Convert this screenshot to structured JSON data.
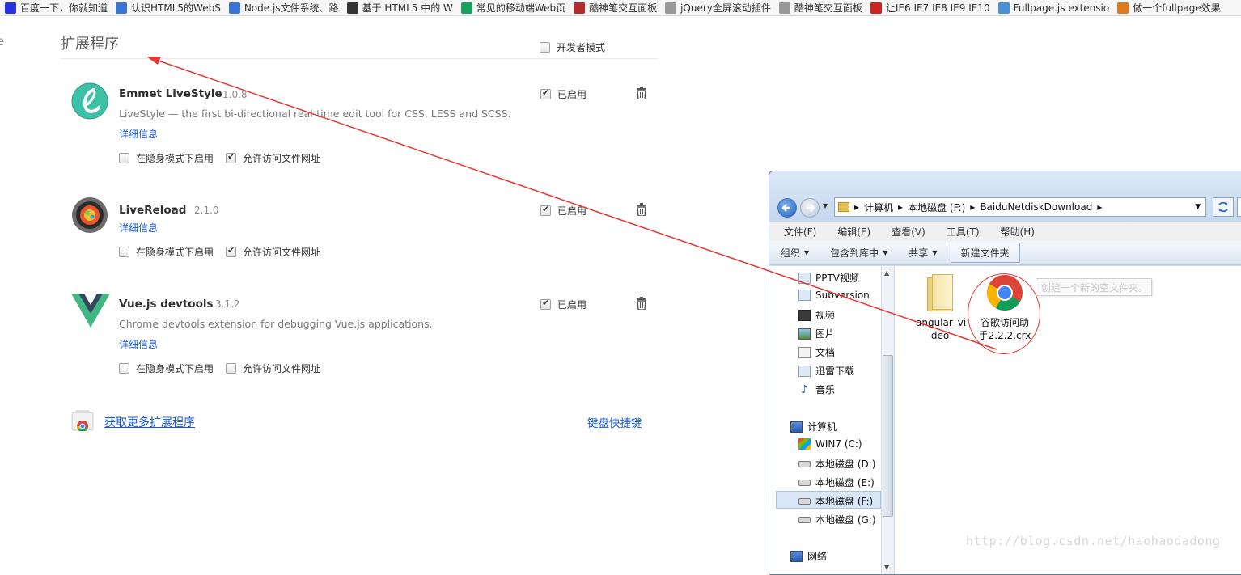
{
  "bookmarks": [
    {
      "label": "百度一下，你就知道",
      "icon": "paw-icon",
      "color": "#2932e1"
    },
    {
      "label": "认识HTML5的WebS",
      "icon": "globe-icon",
      "color": "#3a74d6"
    },
    {
      "label": "Node.js文件系统、路",
      "icon": "globe-icon",
      "color": "#3a74d6"
    },
    {
      "label": "基于 HTML5 中的 W",
      "icon": "github-icon",
      "color": "#333333"
    },
    {
      "label": "常见的移动端Web页",
      "icon": "refresh-icon",
      "color": "#19a15f"
    },
    {
      "label": "酷神笔交互面板",
      "icon": "brand-icon",
      "color": "#b52a2a"
    },
    {
      "label": "jQuery全屏滚动插件",
      "icon": "page-icon",
      "color": "#999999"
    },
    {
      "label": "酷神笔交互面板",
      "icon": "page-icon",
      "color": "#999999"
    },
    {
      "label": "让IE6 IE7 IE8 IE9 IE10",
      "icon": "csdn-icon",
      "color": "#c9251c"
    },
    {
      "label": "Fullpage.js extensio",
      "icon": "cloud-icon",
      "color": "#4a90d9"
    },
    {
      "label": "做一个fullpage效果",
      "icon": "blog-icon",
      "color": "#e07a1a"
    }
  ],
  "left_sliver": "e",
  "extensions_page": {
    "title": "扩展程序",
    "dev_mode_label": "开发者模式",
    "extensions": [
      {
        "name": "Emmet LiveStyle",
        "version": "1.0.8",
        "description": "LiveStyle — the first bi-directional real-time edit tool for CSS, LESS and SCSS.",
        "details_link": "详细信息",
        "enabled_label": "已启用",
        "enabled": true,
        "incognito_label": "在隐身模式下启用",
        "incognito": false,
        "file_access_label": "允许访问文件网址",
        "file_access": true,
        "icon": "livestyle-icon"
      },
      {
        "name": "LiveReload",
        "version": "2.1.0",
        "description": "",
        "details_link": "详细信息",
        "enabled_label": "已启用",
        "enabled": true,
        "incognito_label": "在隐身模式下启用",
        "incognito": false,
        "file_access_label": "允许访问文件网址",
        "file_access": true,
        "icon": "livereload-icon"
      },
      {
        "name": "Vue.js devtools",
        "version": "3.1.2",
        "description": "Chrome devtools extension for debugging Vue.js applications.",
        "details_link": "详细信息",
        "enabled_label": "已启用",
        "enabled": true,
        "incognito_label": "在隐身模式下启用",
        "incognito": false,
        "file_access_label": "允许访问文件网址",
        "file_access": false,
        "icon": "vue-icon"
      }
    ],
    "get_more_label": "获取更多扩展程序",
    "shortcuts_label": "键盘快捷键"
  },
  "explorer": {
    "breadcrumb": [
      "计算机",
      "本地磁盘 (F:)",
      "BaiduNetdiskDownload"
    ],
    "menu": [
      "文件(F)",
      "编辑(E)",
      "查看(V)",
      "工具(T)",
      "帮助(H)"
    ],
    "toolbar": {
      "organize": "组织",
      "include_library": "包含到库中",
      "share": "共享",
      "new_folder": "新建文件夹"
    },
    "nav_items": [
      "PPTV视频",
      "Subversion",
      "视频",
      "图片",
      "文档",
      "迅雷下载",
      "音乐"
    ],
    "computer_label": "计算机",
    "drives": [
      "WIN7 (C:)",
      "本地磁盘 (D:)",
      "本地磁盘 (E:)",
      "本地磁盘 (F:)",
      "本地磁盘 (G:)"
    ],
    "network_label": "网络",
    "files": [
      {
        "name_line1": "angular_vi",
        "name_line2": "deo",
        "type": "folder"
      },
      {
        "name_line1": "谷歌访问助",
        "name_line2": "手2.2.2.crx",
        "type": "chrome-file"
      }
    ],
    "tooltip": "创建一个新的空文件夹。"
  },
  "watermark": "http://blog.csdn.net/haohaodadong",
  "colors": {
    "link": "#1558d6",
    "annotation_red": "#e53935"
  }
}
